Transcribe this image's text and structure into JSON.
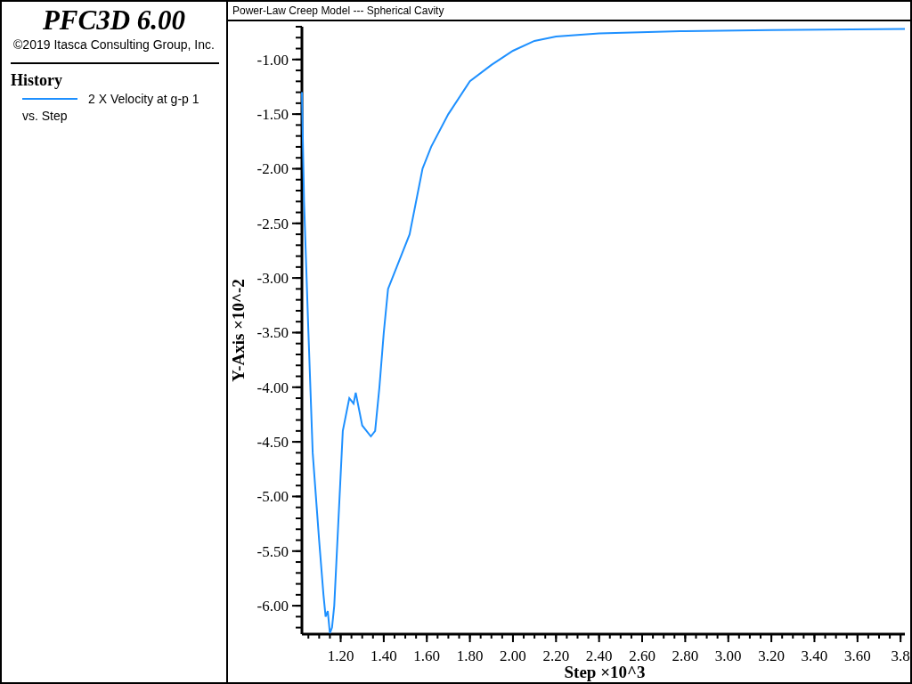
{
  "sidebar": {
    "app_title": "PFC3D 6.00",
    "copyright": "©2019 Itasca Consulting Group, Inc.",
    "legend_heading": "History",
    "legend_suffix": "vs. Step"
  },
  "plot": {
    "title": "Power-Law Creep Model --- Spherical Cavity",
    "chart_data": {
      "type": "line",
      "xlabel": "Step ×10^3",
      "ylabel": "Y-Axis ×10^-2",
      "xlim": [
        1.02,
        3.82
      ],
      "ylim": [
        -6.26,
        -0.7
      ],
      "xticks": [
        {
          "value": 1.2,
          "label": "1.20"
        },
        {
          "value": 1.4,
          "label": "1.40"
        },
        {
          "value": 1.6,
          "label": "1.60"
        },
        {
          "value": 1.8,
          "label": "1.80"
        },
        {
          "value": 2.0,
          "label": "2.00"
        },
        {
          "value": 2.2,
          "label": "2.20"
        },
        {
          "value": 2.4,
          "label": "2.40"
        },
        {
          "value": 2.6,
          "label": "2.60"
        },
        {
          "value": 2.8,
          "label": "2.80"
        },
        {
          "value": 3.0,
          "label": "3.00"
        },
        {
          "value": 3.2,
          "label": "3.20"
        },
        {
          "value": 3.4,
          "label": "3.40"
        },
        {
          "value": 3.6,
          "label": "3.60"
        },
        {
          "value": 3.8,
          "label": "3.8"
        }
      ],
      "yticks": [
        {
          "value": -1,
          "label": "-1.00"
        },
        {
          "value": -1.5,
          "label": "-1.50"
        },
        {
          "value": -2,
          "label": "-2.00"
        },
        {
          "value": -2.5,
          "label": "-2.50"
        },
        {
          "value": -3,
          "label": "-3.00"
        },
        {
          "value": -3.5,
          "label": "-3.50"
        },
        {
          "value": -4,
          "label": "-4.00"
        },
        {
          "value": -4.5,
          "label": "-4.50"
        },
        {
          "value": -5,
          "label": "-5.00"
        },
        {
          "value": -5.5,
          "label": "-5.50"
        },
        {
          "value": -6,
          "label": "-6.00"
        }
      ],
      "x": [
        1.02,
        1.03,
        1.05,
        1.07,
        1.1,
        1.12,
        1.13,
        1.14,
        1.15,
        1.16,
        1.17,
        1.18,
        1.19,
        1.21,
        1.24,
        1.26,
        1.27,
        1.3,
        1.34,
        1.36,
        1.38,
        1.4,
        1.42,
        1.46,
        1.52,
        1.58,
        1.62,
        1.7,
        1.8,
        1.9,
        2.0,
        2.1,
        2.2,
        2.4,
        2.8,
        3.2,
        3.82
      ],
      "series": [
        {
          "name": "2 X Velocity at g-p 1",
          "color": "#1e90ff",
          "values": [
            -1.3,
            -2.3,
            -3.5,
            -4.6,
            -5.4,
            -5.9,
            -6.1,
            -6.05,
            -6.25,
            -6.2,
            -6.0,
            -5.6,
            -5.2,
            -4.4,
            -4.1,
            -4.15,
            -4.05,
            -4.35,
            -4.45,
            -4.4,
            -4.0,
            -3.5,
            -3.1,
            -2.9,
            -2.6,
            -2.0,
            -1.8,
            -1.5,
            -1.2,
            -1.05,
            -0.92,
            -0.83,
            -0.79,
            -0.76,
            -0.74,
            -0.73,
            -0.72
          ]
        }
      ]
    }
  }
}
